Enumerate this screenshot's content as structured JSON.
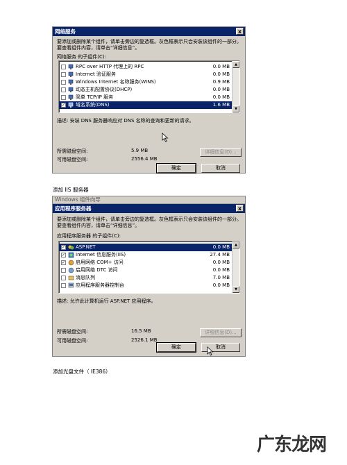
{
  "dialog1": {
    "title": "网络服务",
    "close_glyph": "x",
    "description": "要添加或删除某个组件，请单击旁边的复选框。灰色框表示只会安装该组件的一部分。要查看组件内容，请单击“详细信息”。",
    "list_label": "网络服务 的子组件(C):",
    "items": [
      {
        "label": "RPC over HTTP 代理上的 RPC",
        "size": "0.0 MB",
        "checked": false
      },
      {
        "label": "Internet 验证服务",
        "size": "0.0 MB",
        "checked": false
      },
      {
        "label": "Windows Internet 名称服务(WINS)",
        "size": "0.9 MB",
        "checked": false
      },
      {
        "label": "动态主机配置协议(DHCP)",
        "size": "0.0 MB",
        "checked": false
      },
      {
        "label": "简单 TCP/IP 服务",
        "size": "0.0 MB",
        "checked": false
      },
      {
        "label": "域名系统(DNS)",
        "size": "1.6 MB",
        "checked": true
      }
    ],
    "detail_text": "描述:   安装 DNS 服务器响应对 DNS 名称的查询和更新的请求。",
    "required_label": "所需磁盘空间:",
    "required_value": "5.9 MB",
    "available_label": "可用磁盘空间:",
    "available_value": "2556.4 MB",
    "details_button": "详细信息(D)...",
    "ok_button": "确定",
    "cancel_button": "取消"
  },
  "caption1": "添加 IIS 服务器",
  "dialog2": {
    "header_strip": "Windows 组件向导",
    "title": "应用程序服务器",
    "close_glyph": "x",
    "description": "要添加或删除某个组件，请单击旁边的复选框。灰色框表示只会安装该组件的一部分。要查看组件内容，请单击“详细信息”。",
    "list_label": "应用程序服务器 的子组件(C):",
    "items": [
      {
        "label": "ASP.NET",
        "size": "0.0 MB",
        "checked": true
      },
      {
        "label": "Internet 信息服务(IIS)",
        "size": "27.4 MB",
        "checked": true
      },
      {
        "label": "启用网络 COM+ 访问",
        "size": "0.0 MB",
        "checked": true
      },
      {
        "label": "启用网络 DTC 访问",
        "size": "0.0 MB",
        "checked": false
      },
      {
        "label": "消息队列",
        "size": "7.0 MB",
        "checked": false
      },
      {
        "label": "应用程序服务器控制台",
        "size": "0.0 MB",
        "checked": false
      }
    ],
    "detail_text": "描述:   允许此计算机运行 ASP.NET 应用程序。",
    "required_label": "所需磁盘空间:",
    "required_value": "16.5 MB",
    "available_label": "可用磁盘空间:",
    "available_value": "2526.1 MB",
    "details_button": "详细信息(D)...",
    "ok_button": "确定",
    "cancel_button": "取消"
  },
  "caption2": "添加光盘文件（  IE386）",
  "watermark": "广东龙网",
  "colors": {
    "titlebar": "#0a246a",
    "dialog_bg": "#d4d0c8",
    "selection": "#0a246a"
  }
}
